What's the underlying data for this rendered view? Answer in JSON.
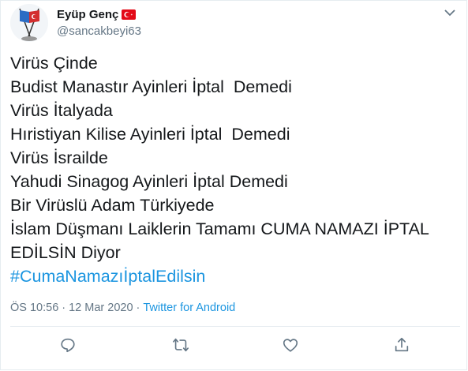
{
  "tweet": {
    "display_name": "Eyüp Genç",
    "handle": "@sancakbeyi63",
    "lines": [
      "Virüs Çinde",
      "Budist Manastır Ayinleri İptal  Demedi",
      "Virüs İtalyada",
      "Hıristiyan Kilise Ayinleri İptal  Demedi",
      "Virüs İsrailde",
      "Yahudi Sinagog Ayinleri İptal Demedi",
      "Bir Virüslü Adam Türkiyede",
      "İslam Düşmanı Laiklerin Tamamı CUMA NAMAZI İPTAL",
      "EDİLSİN Diyor"
    ],
    "hashtag": "#CumaNamazıİptalEdilsin",
    "time": "ÖS 10:56",
    "separator": "·",
    "date": "12 Mar 2020",
    "source": "Twitter for Android"
  },
  "icons": {
    "reply": "reply-icon",
    "retweet": "retweet-icon",
    "like": "heart-icon",
    "share": "share-icon",
    "more": "chevron-down-icon",
    "flag": "turkey-flag-icon"
  },
  "colors": {
    "text": "#14171a",
    "secondary": "#657786",
    "link": "#1b95e0",
    "icon": "#657786"
  }
}
